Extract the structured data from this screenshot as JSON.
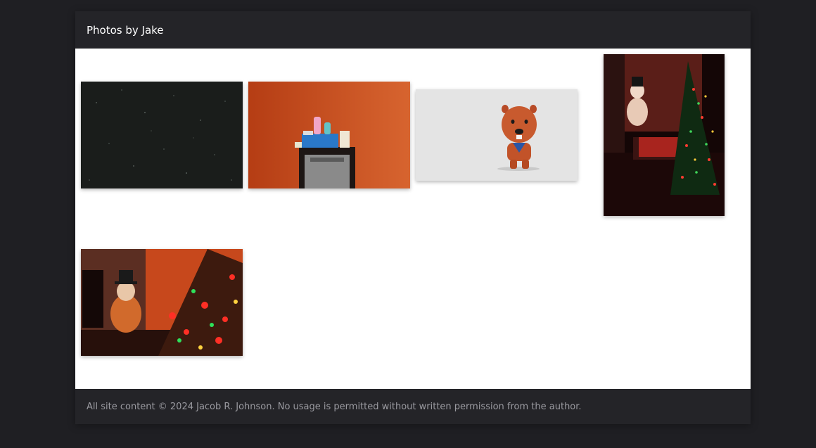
{
  "header": {
    "title": "Photos by Jake"
  },
  "gallery": {
    "photos": [
      {
        "subject": "night-sky-stars-photo"
      },
      {
        "subject": "basket-on-cabinet-orange-wall-photo"
      },
      {
        "subject": "beaver-toy-figure-photo"
      },
      {
        "subject": "snowman-lamp-christmas-tree-portrait-photo"
      },
      {
        "subject": "snowman-lamp-christmas-tree-landscape-photo"
      }
    ]
  },
  "footer": {
    "copyright": "All site content © 2024 Jacob R. Johnson. No usage is permitted without written permission from the author."
  },
  "colors": {
    "page_background": "#1f1f23",
    "bar_background": "#242428",
    "gallery_background": "#ffffff",
    "title_text": "#ffffff",
    "footer_text": "#9a9aa0"
  }
}
